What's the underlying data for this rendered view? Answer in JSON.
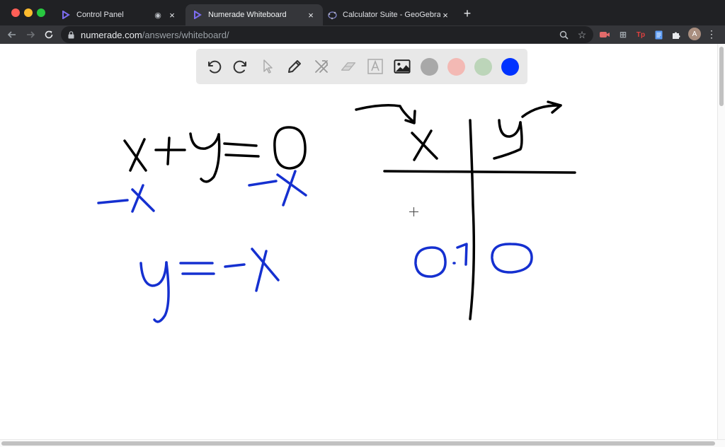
{
  "browser": {
    "tabs": [
      {
        "title": "Control Panel",
        "active": false
      },
      {
        "title": "Numerade Whiteboard",
        "active": true
      },
      {
        "title": "Calculator Suite - GeoGebra",
        "active": false
      }
    ],
    "url_host": "numerade.com",
    "url_path": "/answers/whiteboard/",
    "profile_initial": "A",
    "extension_text": "Tp"
  },
  "whiteboard": {
    "tools": [
      "undo",
      "redo",
      "select",
      "pen",
      "tools",
      "eraser",
      "text",
      "image"
    ],
    "colors": {
      "gray": "#a8a8a8",
      "pink": "#f3b9b4",
      "green": "#bcd5b9",
      "blue": "#0033ff"
    },
    "ink_colors": {
      "black": "#000000",
      "blue": "#1530d0"
    }
  }
}
